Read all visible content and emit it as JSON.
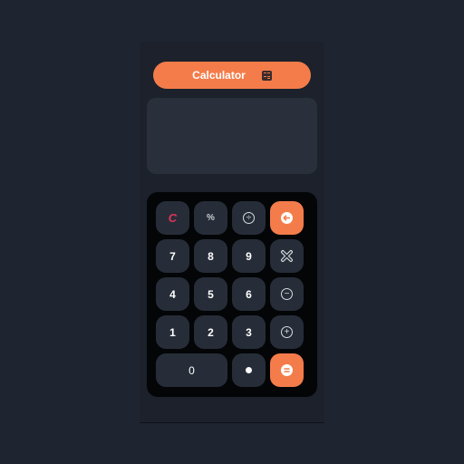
{
  "header": {
    "title": "Calculator",
    "icon": "calculator-icon"
  },
  "display": {
    "value": ""
  },
  "keys": {
    "clear": "C",
    "percent": "%",
    "divide": "÷",
    "backspace": "⌫",
    "seven": "7",
    "eight": "8",
    "nine": "9",
    "multiply": "×",
    "four": "4",
    "five": "5",
    "six": "6",
    "minus": "−",
    "one": "1",
    "two": "2",
    "three": "3",
    "plus": "+",
    "zero": "0",
    "decimal": "•",
    "equals": "="
  },
  "colors": {
    "accent": "#f47c4a",
    "clear": "#e0335a",
    "background": "#1f2530",
    "key": "#272d38",
    "keypad": "#030507"
  }
}
